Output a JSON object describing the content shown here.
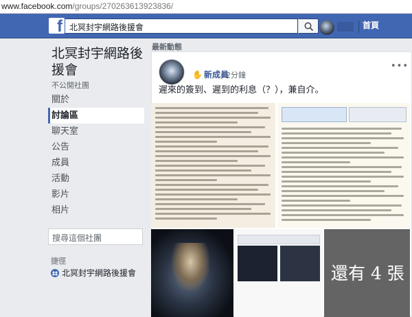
{
  "browser": {
    "url_host": "www.facebook.com",
    "url_path": "/groups/270263613923836/"
  },
  "topbar": {
    "search_value": "北冥封宇網路後援會",
    "home_label": "首頁"
  },
  "group": {
    "title": "北冥封宇網路後援會",
    "privacy": "不公開社團",
    "nav": [
      {
        "label": "關於"
      },
      {
        "label": "討論區"
      },
      {
        "label": "聊天室"
      },
      {
        "label": "公告"
      },
      {
        "label": "成員"
      },
      {
        "label": "活動"
      },
      {
        "label": "影片"
      },
      {
        "label": "相片"
      }
    ],
    "search_placeholder": "搜尋這個社團",
    "shortcuts_title": "捷徑",
    "shortcut_name": "北冥封宇網路後援會"
  },
  "feed": {
    "header": "最新動態",
    "post": {
      "author_badge": "新成員",
      "time": "12分鐘",
      "text": "遲來的簽到、遲到的利息（？），兼自介。",
      "more_photos": "還有 4 張"
    }
  },
  "colors": {
    "fb_blue": "#4267b2",
    "page_bg": "#e9ebee"
  }
}
